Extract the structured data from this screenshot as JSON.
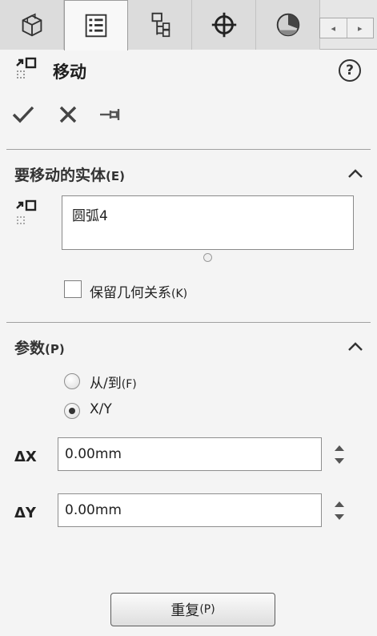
{
  "tabs": [
    {
      "icon": "feature-manager-icon",
      "active": false
    },
    {
      "icon": "property-manager-icon",
      "active": true
    },
    {
      "icon": "configuration-manager-icon",
      "active": false
    },
    {
      "icon": "dimxpert-manager-icon",
      "active": false
    },
    {
      "icon": "display-manager-icon",
      "active": false
    }
  ],
  "scroll": {
    "left": "◂",
    "right": "▸"
  },
  "header": {
    "title": "移动",
    "help": "?"
  },
  "actions": [
    {
      "icon": "ok-check-icon"
    },
    {
      "icon": "cancel-x-icon"
    },
    {
      "icon": "pushpin-icon"
    }
  ],
  "entities_section": {
    "title": "要移动的实体",
    "hotkey": "(E)",
    "list_items": [
      "圆弧4"
    ],
    "keep_relations_label": "保留几何关系",
    "keep_relations_hotkey": "(K)",
    "keep_relations_checked": false
  },
  "params_section": {
    "title": "参数",
    "hotkey": "(P)",
    "option_from_to": "从/到",
    "option_from_to_hotkey": "(F)",
    "option_xy": "X/Y",
    "selected": "X/Y",
    "delta_x_label": "ΔX",
    "delta_x_value": "0.00mm",
    "delta_y_label": "ΔY",
    "delta_y_value": "0.00mm"
  },
  "repeat_button": {
    "label": "重复",
    "hotkey": "(P)"
  },
  "colors": {
    "panel_bg": "#f4f4f4",
    "tab_bg": "#dcdcdc",
    "active_tab_bg": "#f8f8f8",
    "accent_gray": "#333333"
  }
}
